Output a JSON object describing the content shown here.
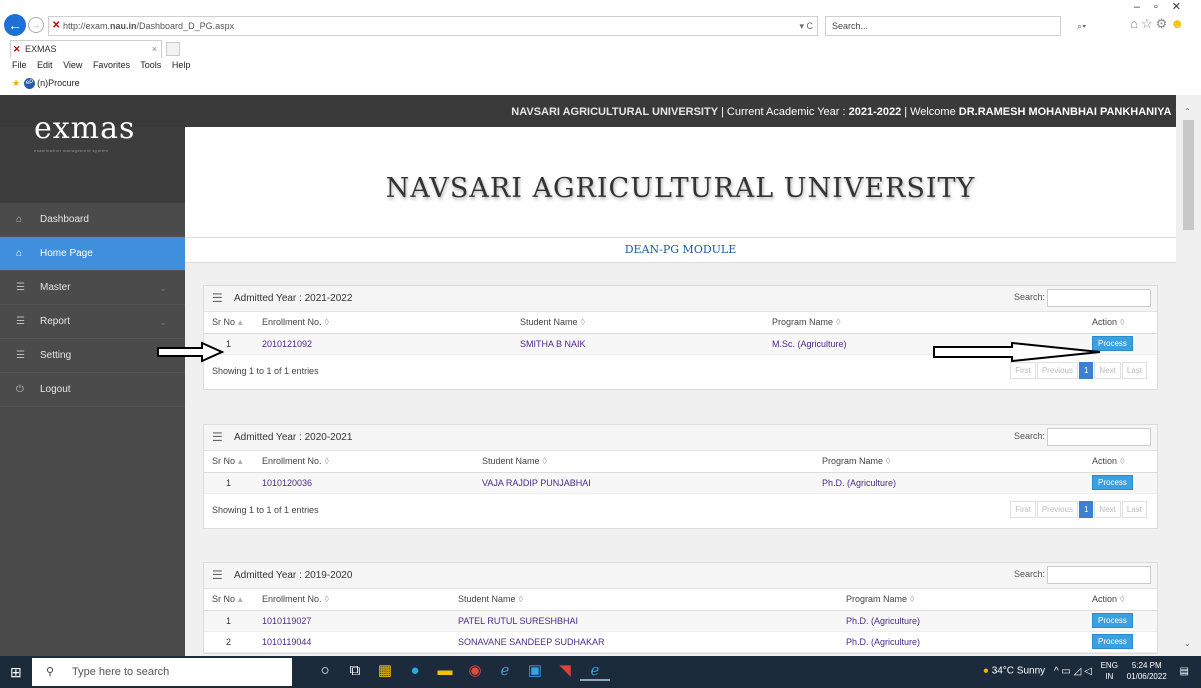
{
  "browser": {
    "url_prefix": "http://exam.",
    "url_domain": "nau.in",
    "url_path": "/Dashboard_D_PG.aspx",
    "refresh": "▾ C",
    "search_placeholder": "Search...",
    "search_btn": "⌕▾",
    "tab_title": "EXMAS",
    "menu": [
      "File",
      "Edit",
      "View",
      "Favorites",
      "Tools",
      "Help"
    ],
    "favorite": "(n)Procure",
    "favorite_badge": "eP"
  },
  "header": {
    "logo_text": "exmas",
    "logo_sub": "examination management system",
    "university": "NAVSARI AGRICULTURAL UNIVERSITY",
    "academic_label": "Current Academic Year :",
    "academic_year": "2021-2022",
    "welcome_label": "Welcome",
    "user_name": "DR.RAMESH MOHANBHAI PANKHANIYA"
  },
  "sidebar": {
    "items": [
      {
        "label": "Dashboard",
        "icon": "home-icon"
      },
      {
        "label": "Home Page",
        "icon": "home-icon"
      },
      {
        "label": "Master",
        "icon": "list-icon"
      },
      {
        "label": "Report",
        "icon": "list-icon"
      },
      {
        "label": "Setting",
        "icon": "list-icon"
      },
      {
        "label": "Logout",
        "icon": "power-icon"
      }
    ]
  },
  "main": {
    "title": "NAVSARI AGRICULTURAL UNIVERSITY",
    "module": "DEAN-PG MODULE",
    "search_label": "Search:",
    "columns": [
      "Sr No",
      "Enrollment No.",
      "Student Name",
      "Program Name",
      "Action"
    ],
    "process_label": "Process",
    "pager": [
      "First",
      "Previous",
      "1",
      "Next",
      "Last"
    ],
    "cards": [
      {
        "title": "Admitted Year : 2021-2022",
        "info": "Showing 1 to 1 of 1 entries",
        "rows": [
          {
            "sr": "1",
            "enroll": "2010121092",
            "name": "SMITHA B NAIK",
            "program": "M.Sc. (Agriculture)"
          }
        ]
      },
      {
        "title": "Admitted Year : 2020-2021",
        "info": "Showing 1 to 1 of 1 entries",
        "rows": [
          {
            "sr": "1",
            "enroll": "1010120036",
            "name": "VAJA RAJDIP PUNJABHAI",
            "program": "Ph.D. (Agriculture)"
          }
        ]
      },
      {
        "title": "Admitted Year : 2019-2020",
        "info": "",
        "rows": [
          {
            "sr": "1",
            "enroll": "1010119027",
            "name": "PATEL RUTUL SURESHBHAI",
            "program": "Ph.D. (Agriculture)"
          },
          {
            "sr": "2",
            "enroll": "1010119044",
            "name": "SONAVANE SANDEEP SUDHAKAR",
            "program": "Ph.D. (Agriculture)"
          }
        ]
      }
    ]
  },
  "taskbar": {
    "search_placeholder": "Type here to search",
    "weather": "34°C Sunny",
    "lang1": "ENG",
    "lang2": "IN",
    "time": "5:24 PM",
    "date": "01/06/2022"
  }
}
